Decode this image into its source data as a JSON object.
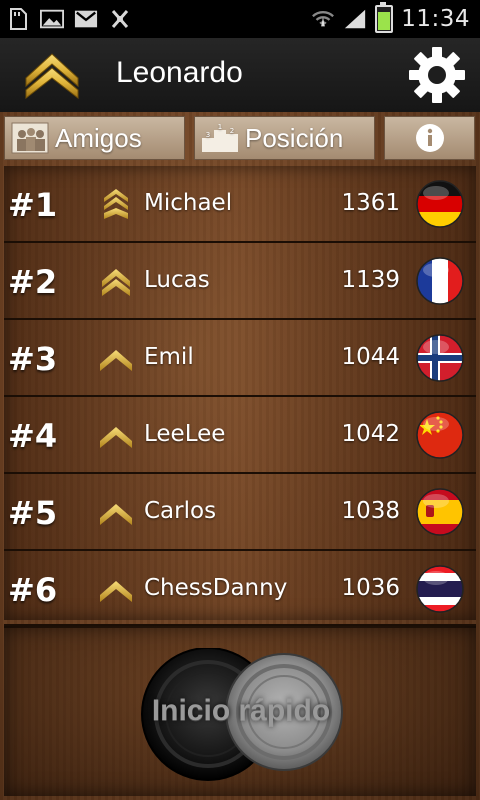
{
  "status_bar": {
    "time": "11:34",
    "icons": [
      "sd-card-icon",
      "image-icon",
      "gmail-icon",
      "usb-debug-icon",
      "wifi-icon",
      "signal-icon",
      "battery-icon"
    ]
  },
  "header": {
    "player_name": "Leonardo",
    "rank_icon": "corporal-chevron-icon",
    "settings_icon": "gear-icon"
  },
  "tabs": {
    "friends_label": "Amigos",
    "position_label": "Posición",
    "info_icon": "info-icon"
  },
  "leaderboard": [
    {
      "rank": "#1",
      "name": "Michael",
      "score": "1361",
      "country": "Germany",
      "flag_icon": "germany-flag-icon",
      "rank_badge": "staff-sergeant-icon"
    },
    {
      "rank": "#2",
      "name": "Lucas",
      "score": "1139",
      "country": "France",
      "flag_icon": "france-flag-icon",
      "rank_badge": "corporal-icon"
    },
    {
      "rank": "#3",
      "name": "Emil",
      "score": "1044",
      "country": "Norway",
      "flag_icon": "norway-flag-icon",
      "rank_badge": "private-icon"
    },
    {
      "rank": "#4",
      "name": "LeeLee",
      "score": "1042",
      "country": "China",
      "flag_icon": "china-flag-icon",
      "rank_badge": "private-icon"
    },
    {
      "rank": "#5",
      "name": "Carlos",
      "score": "1038",
      "country": "Spain",
      "flag_icon": "spain-flag-icon",
      "rank_badge": "private-icon"
    },
    {
      "rank": "#6",
      "name": "ChessDanny",
      "score": "1036",
      "country": "Thailand",
      "flag_icon": "thailand-flag-icon",
      "rank_badge": "private-icon"
    }
  ],
  "quick_start": {
    "label": "Inicio rápido"
  },
  "colors": {
    "header_bg": "#1e1e1e",
    "wood_dark": "#4a2a14",
    "wood_light": "#8a5a34",
    "gold": "#e0b43a",
    "tab_bg": "#b7a088"
  }
}
